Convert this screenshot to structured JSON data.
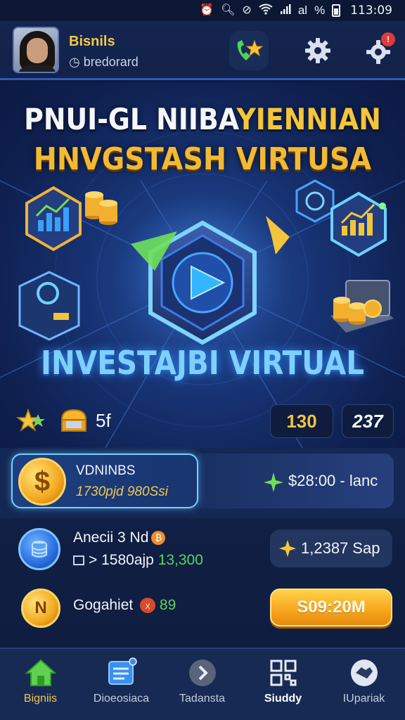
{
  "status_bar": {
    "time": "113:09",
    "battery_text": "%",
    "signal_text": "al",
    "icons": [
      "alarm-icon",
      "search-icon",
      "mute-icon",
      "wifi-icon",
      "signal-icon",
      "battery-icon"
    ]
  },
  "header": {
    "user_name": "Bisnils",
    "user_sub": "bredorard",
    "notification_count": "!",
    "buttons": [
      "phone-star-icon",
      "gear-icon",
      "notification-gear-icon"
    ]
  },
  "hero": {
    "title_line1_a": "PNUI-GL NIIBA",
    "title_line1_b": "YIENNIAN",
    "title_line2": "HNVGSTASH VIRTUSA",
    "subtitle": "INVESTAJBI VIRTUAL",
    "level": "5f",
    "score": "130",
    "bonus": "237"
  },
  "balance": {
    "label": "VDNINBS",
    "value": "1730pjd 980Ssi",
    "rate": "$28:00 - lanc",
    "coin_symbol": "$"
  },
  "assets": {
    "item1": {
      "name": "Anecii 3 Nd",
      "stat_a": "> 1580ajp",
      "stat_b": "13,300",
      "pill_value": "1,2387",
      "pill_unit": "Sap"
    },
    "item2": {
      "name": "Gogahiet",
      "chip": "x",
      "value": "89",
      "coin_symbol": "N",
      "cta": "S09:20M"
    }
  },
  "nav": [
    {
      "label": "Bigniis",
      "icon": "home-icon"
    },
    {
      "label": "Dioeosiaca",
      "icon": "notes-icon"
    },
    {
      "label": "Tadansta",
      "icon": "arrow-icon"
    },
    {
      "label": "Siuddy",
      "icon": "grid-icon"
    },
    {
      "label": "IUpariak",
      "icon": "handshake-icon"
    }
  ],
  "colors": {
    "background": "#0d1b3d",
    "accent_gold": "#f3c84b",
    "accent_blue": "#6fd2ff",
    "positive_green": "#57d65e",
    "cta_orange": "#f6a51c",
    "badge_red": "#e23a3a"
  }
}
